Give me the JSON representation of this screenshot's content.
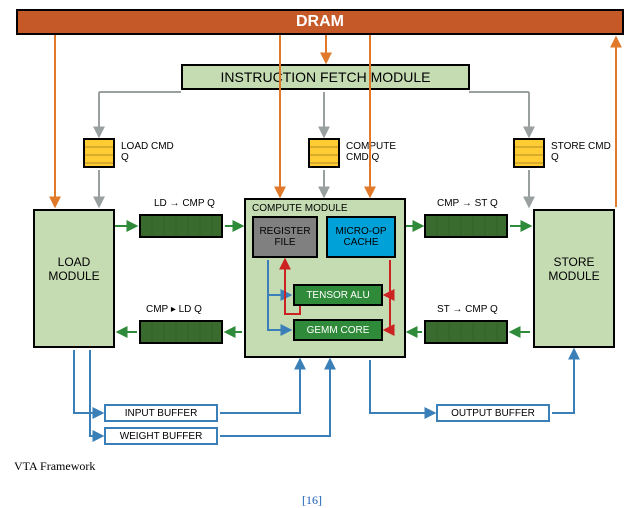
{
  "dram": "DRAM",
  "ifm": "INSTRUCTION FETCH MODULE",
  "load_cmdq": "LOAD CMD Q",
  "compute_cmdq": "COMPUTE CMD Q",
  "store_cmdq": "STORE CMD Q",
  "ld_cmpq": "LD → CMP Q",
  "cmp_stq": "CMP → ST Q",
  "cmp_ldq": "CMP ▸ LD Q",
  "st_cmpq": "ST → CMP Q",
  "load_module": "LOAD MODULE",
  "compute_module": "COMPUTE MODULE",
  "store_module": "STORE MODULE",
  "register_file": "REGISTER FILE",
  "micro_op_cache": "MICRO-OP CACHE",
  "tensor_alu": "TENSOR ALU",
  "gemm_core": "GEMM CORE",
  "input_buffer": "INPUT BUFFER",
  "weight_buffer": "WEIGHT BUFFER",
  "output_buffer": "OUTPUT BUFFER",
  "caption": "VTA Framework",
  "cite": "[16]"
}
